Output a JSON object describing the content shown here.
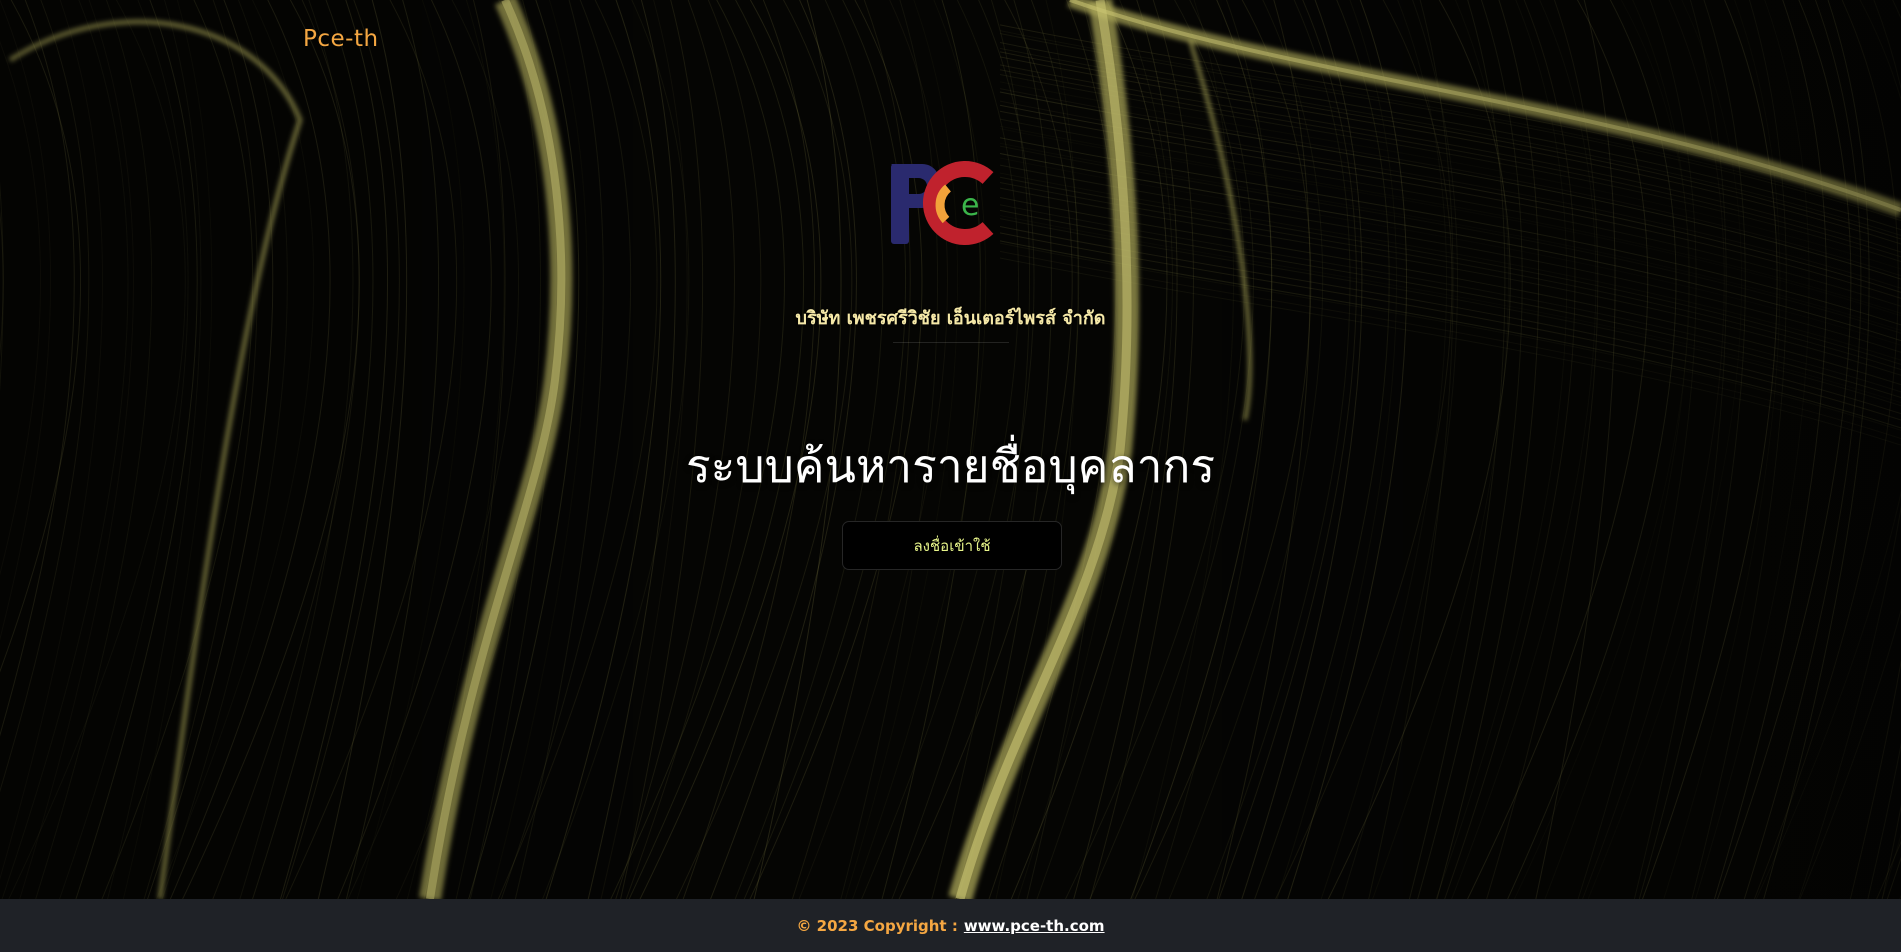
{
  "header": {
    "brand": "Pce-th"
  },
  "logo": {
    "alt": "PCE company logo",
    "letters": [
      "P",
      "C",
      "e"
    ]
  },
  "main": {
    "company_name": "บริษัท เพชรศรีวิชัย เอ็นเตอร์ไพรส์ จำกัด",
    "title": "ระบบค้นหารายชื่อบุคลากร",
    "login_label": "ลงชื่อเข้าใช้"
  },
  "footer": {
    "copyright": "© 2023 Copyright :",
    "link_text": "www.pce-th.com"
  },
  "colors": {
    "brand": "#f5a742",
    "accent_gold": "#b6b35c",
    "login_text": "#e8f58a",
    "footer_bg": "#1f2227",
    "logo_blue": "#2a2a6e",
    "logo_red": "#c0222d",
    "logo_orange": "#f2a23a",
    "logo_green": "#3bb54a"
  }
}
